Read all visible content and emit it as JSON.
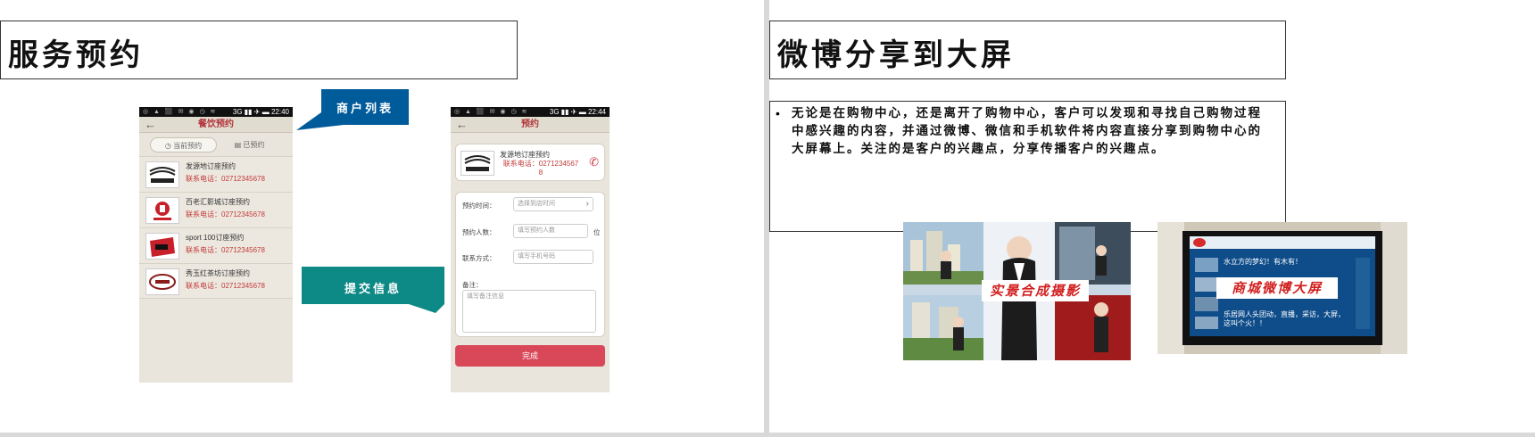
{
  "left_slide": {
    "title": "服务预约",
    "callout_merchants": "商户列表",
    "callout_submit": "提交信息"
  },
  "phone1": {
    "status_time": "22:40",
    "status_net": "3G",
    "nav_title": "餐饮预约",
    "tab_current": "当前预约",
    "tab_done": "已预约",
    "items": [
      {
        "name": "发源地订座预约",
        "tel": "联系电话：02712345678"
      },
      {
        "name": "百老汇影城订座预约",
        "tel": "联系电话：02712345678"
      },
      {
        "name": "sport 100订座预约",
        "tel": "联系电话：02712345678"
      },
      {
        "name": "秀玉红茶坊订座预约",
        "tel": "联系电话：02712345678"
      }
    ]
  },
  "phone2": {
    "status_time": "22:44",
    "status_net": "3G",
    "nav_title": "预约",
    "shop_name": "发源地订座预约",
    "shop_tel": "联系电话：0271234567\n8",
    "label_time": "预约时间：",
    "placeholder_time": "选择到店时间",
    "label_people": "预约人数：",
    "placeholder_people": "填写预约人数",
    "unit_people": "位",
    "label_contact": "联系方式：",
    "placeholder_contact": "填写手机号码",
    "label_note": "备注：",
    "placeholder_note": "填写备注信息",
    "submit_label": "完成"
  },
  "right_slide": {
    "title": "微博分享到大屏",
    "bullet": "无论是在购物中心，还是离开了购物中心，客户可以发现和寻找自己购物过程中感兴趣的内容，并通过微博、微信和手机软件将内容直接分享到购物中心的大屏幕上。关注的是客户的兴趣点，分享传播客户的兴趣点。",
    "photo1_caption": "实景合成摄影",
    "photo2_caption": "商城微博大屏",
    "screen_line1": "水立方的梦幻！有木有！",
    "screen_line2": "乐居网人头团动，直播，采访，大屏，这叫个火！！"
  }
}
